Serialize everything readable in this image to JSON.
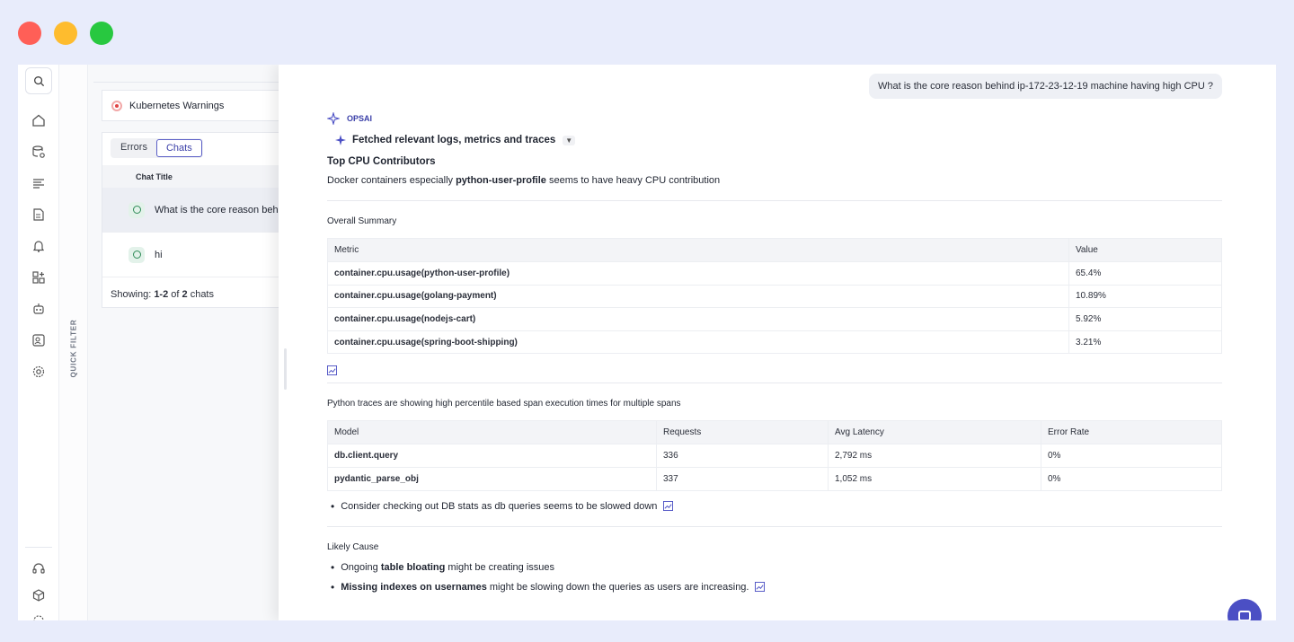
{
  "sidebar": {
    "icons": [
      "search-icon",
      "home-icon",
      "database-icon",
      "logs-icon",
      "document-icon",
      "alert-icon",
      "apps-icon",
      "bot-icon",
      "user-search-icon",
      "settings-icon",
      "headset-icon",
      "box-icon",
      "gear-icon"
    ]
  },
  "quick_filter": {
    "label": "QUICK FILTER"
  },
  "list_panel": {
    "warning_card": {
      "label": "Kubernetes Warnings"
    },
    "tabs": [
      {
        "label": "Errors"
      },
      {
        "label": "Chats",
        "active": true
      }
    ],
    "table_header": "Chat Title",
    "chats": [
      {
        "title": "What is the core reason behi"
      },
      {
        "title": "hi"
      }
    ],
    "showing": {
      "prefix": "Showing: ",
      "range": "1-2",
      "of": " of ",
      "total": "2",
      "suffix": " chats"
    }
  },
  "chat": {
    "user_question": "What is the core reason behind ip-172-23-12-19 machine having high CPU ?",
    "assistant_name": "OPSAI",
    "fetched_label": "Fetched relevant logs, metrics and traces",
    "top_heading": "Top CPU Contributors",
    "top_text_pre": "Docker containers especially ",
    "top_text_bold": "python-user-profile",
    "top_text_post": " seems to have heavy CPU contribution",
    "summary_heading": "Overall Summary",
    "summary_table": {
      "headers": [
        "Metric",
        "Value"
      ],
      "rows": [
        [
          "container.cpu.usage(python-user-profile)",
          "65.4%"
        ],
        [
          "container.cpu.usage(golang-payment)",
          "10.89%"
        ],
        [
          "container.cpu.usage(nodejs-cart)",
          "5.92%"
        ],
        [
          "container.cpu.usage(spring-boot-shipping)",
          "3.21%"
        ]
      ]
    },
    "traces_heading": "Python traces are showing high percentile based span execution times for multiple spans",
    "traces_table": {
      "headers": [
        "Model",
        "Requests",
        "Avg Latency",
        "Error Rate"
      ],
      "rows": [
        [
          "db.client.query",
          "336",
          "2,792 ms",
          "0%"
        ],
        [
          "pydantic_parse_obj",
          "337",
          "1,052 ms",
          "0%"
        ]
      ]
    },
    "traces_bullet": "Consider checking out DB stats as db queries seems to be slowed down",
    "cause_heading": "Likely Cause",
    "cause_bullets": [
      {
        "pre": "Ongoing ",
        "bold": "table bloating",
        "post": " might be creating issues"
      },
      {
        "pre": "",
        "bold": "Missing indexes on usernames",
        "post": " might be slowing down the queries as users are increasing."
      }
    ]
  },
  "colors": {
    "accent": "#4b4fc4",
    "background": "#e8ecfb"
  }
}
